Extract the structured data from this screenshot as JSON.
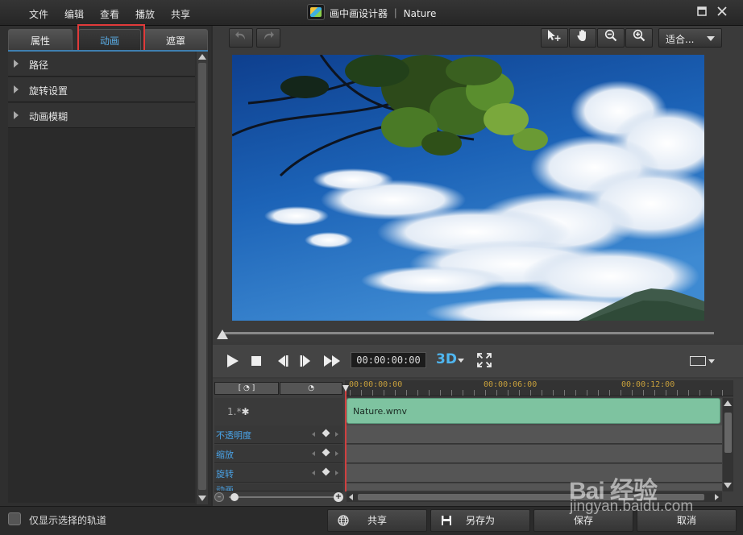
{
  "menu": {
    "items": [
      {
        "label": "文件"
      },
      {
        "label": "编辑"
      },
      {
        "label": "查看"
      },
      {
        "label": "播放"
      },
      {
        "label": "共享"
      }
    ]
  },
  "window": {
    "title": "画中画设计器 ｜ Nature",
    "maximize_icon": "maximize-icon",
    "close_icon": "close-icon"
  },
  "left_panel": {
    "tabs": [
      {
        "label": "属性",
        "active": false
      },
      {
        "label": "动画",
        "active": true
      },
      {
        "label": "遮罩",
        "active": false
      }
    ],
    "properties": [
      {
        "label": "路径"
      },
      {
        "label": "旋转设置"
      },
      {
        "label": "动画模糊"
      }
    ]
  },
  "toolbar": {
    "undo_icon": "undo-icon",
    "redo_icon": "redo-icon",
    "select_tool_icon": "select-move-icon",
    "pan_tool_icon": "hand-icon",
    "zoom_out_icon": "zoom-out-icon",
    "zoom_in_icon": "zoom-in-icon",
    "fit_select": "适合..."
  },
  "transport": {
    "timecode": "00:00:00:00",
    "three_d_label": "3D",
    "seek_position_fraction": 0.0
  },
  "timeline": {
    "ruler": [
      "00:00:00:00",
      "00:00:06:00",
      "00:00:12:00"
    ],
    "track": {
      "label": "1.*",
      "clip_name": "Nature.wmv"
    },
    "keyframe_rows": [
      {
        "label": "不透明度"
      },
      {
        "label": "缩放"
      },
      {
        "label": "旋转"
      },
      {
        "label": "动画"
      }
    ]
  },
  "bottom": {
    "only_selected_tracks_label": "仅显示选择的轨道",
    "share_label": "共享",
    "save_as_label": "另存为",
    "save_label": "保存",
    "cancel_label": "取消"
  },
  "watermark": {
    "logo": "Bai 经验",
    "url": "jingyan.baidu.com"
  },
  "colors": {
    "accent": "#5aaee8",
    "highlight_box": "#e03a3a",
    "clip": "#7ec3a0",
    "playhead": "#d04040",
    "ruler_text": "#c8a03c"
  }
}
